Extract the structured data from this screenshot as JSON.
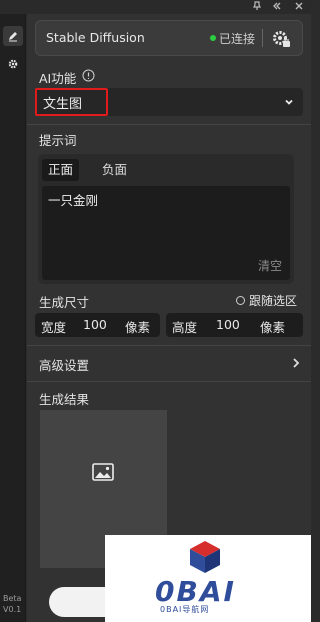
{
  "titlebar": {
    "pin_icon": "pin-icon",
    "collapse_icon": "double-chevron-left-icon",
    "close_icon": "close-icon"
  },
  "sidebar": {
    "items": [
      {
        "icon": "pencil-icon",
        "active": true
      },
      {
        "icon": "gear-icon",
        "active": false
      }
    ],
    "beta_label": "Beta",
    "version_label": "V0.1"
  },
  "engine": {
    "name": "Stable Diffusion",
    "status": "已连接",
    "status_color": "#2ecc40",
    "settings_icon": "gear-plug-icon"
  },
  "ai_function": {
    "label": "AI功能",
    "info_icon": "info-circle-icon",
    "selected": "文生图",
    "highlight_color": "#e01b1b"
  },
  "prompt": {
    "label": "提示词",
    "tabs": [
      "正面",
      "负面"
    ],
    "active_tab": 0,
    "value": "一只金刚",
    "clear_label": "清空"
  },
  "size": {
    "label": "生成尺寸",
    "follow_label": "跟随选区",
    "width_label": "宽度",
    "width_value": "100",
    "width_unit": "像素",
    "height_label": "高度",
    "height_value": "100",
    "height_unit": "像素"
  },
  "advanced": {
    "label": "高级设置"
  },
  "result": {
    "label": "生成结果",
    "placeholder_icon": "image-icon"
  },
  "watermark": {
    "logo_text": "0BAI",
    "sub_text": "0BAI导航网"
  }
}
